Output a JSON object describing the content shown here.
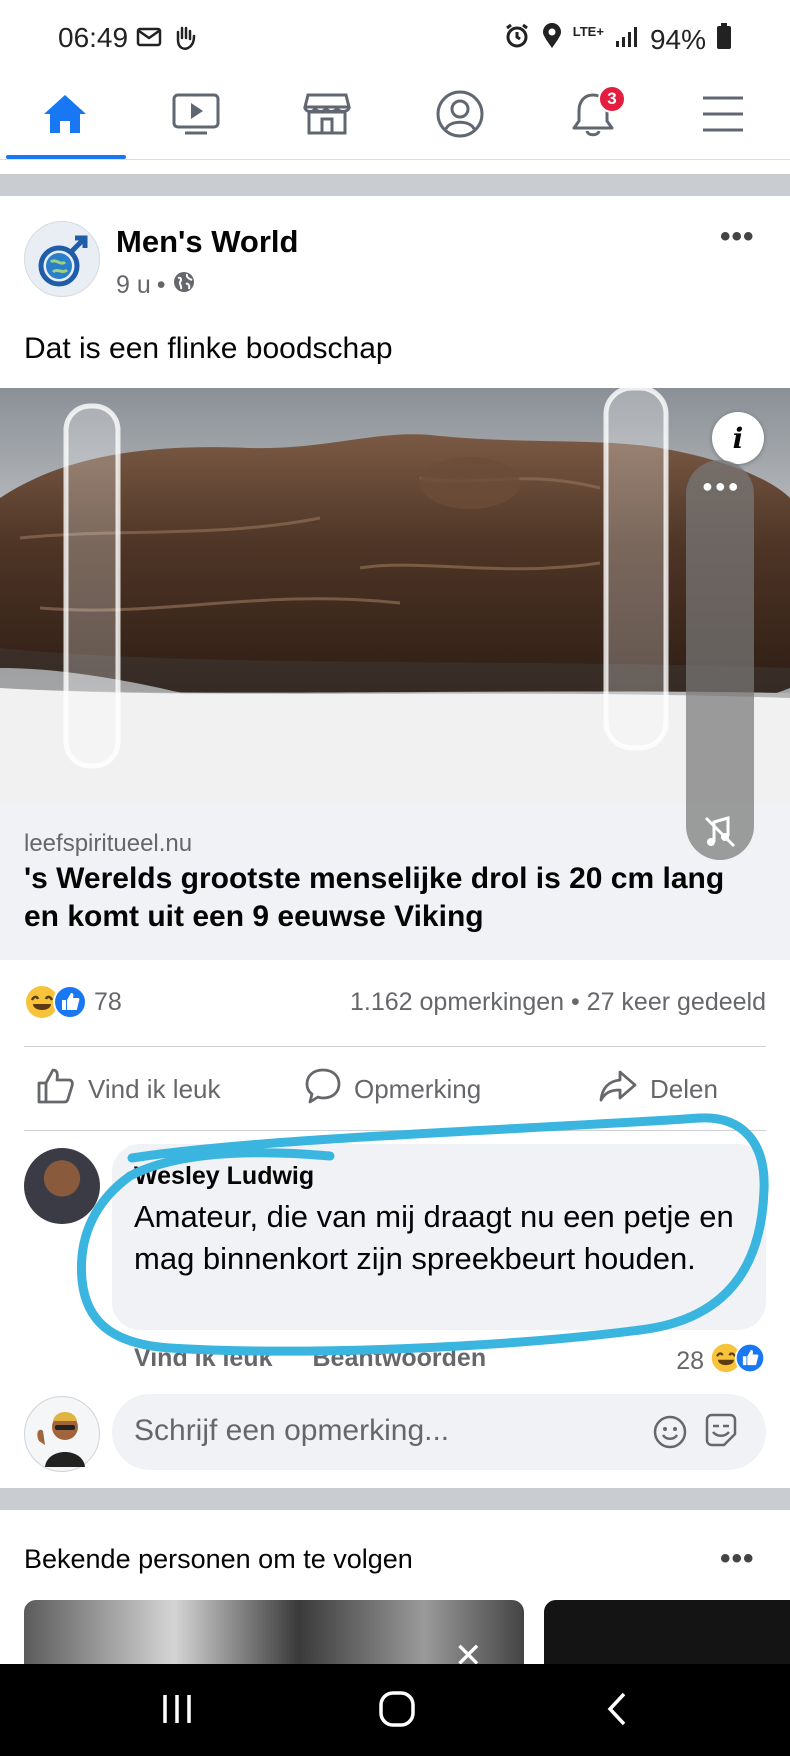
{
  "status_bar": {
    "time": "06:49",
    "network": "LTE+",
    "battery": "94%"
  },
  "nav": {
    "tabs": [
      "home-icon",
      "video-icon",
      "marketplace-icon",
      "profile-icon",
      "notifications-icon",
      "menu-icon"
    ],
    "notification_count": "3",
    "accent_color": "#1877f2"
  },
  "post": {
    "page_name": "Men's World",
    "time": "9 u",
    "text": "Dat is een flinke boodschap",
    "link": {
      "domain": "leefspiritueel.nu",
      "title": "'s Werelds grootste menselijke drol is 20 cm lang en komt uit een 9 eeuwse Viking"
    },
    "reaction_count": "78",
    "stats": "1.162 opmerkingen • 27 keer gedeeld",
    "actions": {
      "like": "Vind ik leuk",
      "comment": "Opmerking",
      "share": "Delen"
    }
  },
  "comment": {
    "author": "Wesley Ludwig",
    "text": "Amateur,  die van mij draagt nu een petje en mag binnenkort zijn spreekbeurt houden.",
    "like": "Vind ik leuk",
    "reply": "Beantwoorden",
    "reaction_count": "28"
  },
  "write_comment": {
    "placeholder": "Schrijf een opmerking..."
  },
  "suggestions": {
    "title": "Bekende personen om te volgen"
  }
}
